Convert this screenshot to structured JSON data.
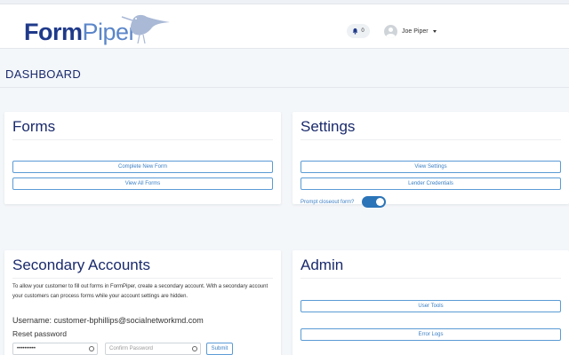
{
  "header": {
    "logo": {
      "part1": "Form",
      "part2": "Piper"
    },
    "notifications": {
      "count": "0"
    },
    "user": {
      "name": "Joe Piper"
    }
  },
  "page": {
    "title": "DASHBOARD"
  },
  "forms_card": {
    "title": "Forms",
    "buttons": {
      "complete_new": "Complete New Form",
      "view_all": "View All Forms"
    }
  },
  "settings_card": {
    "title": "Settings",
    "buttons": {
      "view_settings": "View Settings",
      "lender_credentials": "Lender Credentials"
    },
    "toggle": {
      "label": "Prompt closeout form?",
      "state": "on"
    }
  },
  "secondary_card": {
    "title": "Secondary Accounts",
    "description": "To allow your customer to fill out forms in FormPiper, create a secondary account. With a secondary account your customers can process forms while your account settings are hidden.",
    "username_line": "Username: customer-bphillips@socialnetworkmd.com",
    "reset_label": "Reset password",
    "password_value": "••••••••••",
    "confirm_placeholder": "Confirm Password",
    "submit_label": "Submit"
  },
  "admin_card": {
    "title": "Admin",
    "buttons": {
      "user_tools": "User Tools",
      "error_logs": "Error Logs"
    }
  },
  "colors": {
    "brand_dark": "#1f3a8a",
    "brand_light": "#5b86c9",
    "accent": "#3b7fc4",
    "toggle_on": "#2b74b8"
  }
}
